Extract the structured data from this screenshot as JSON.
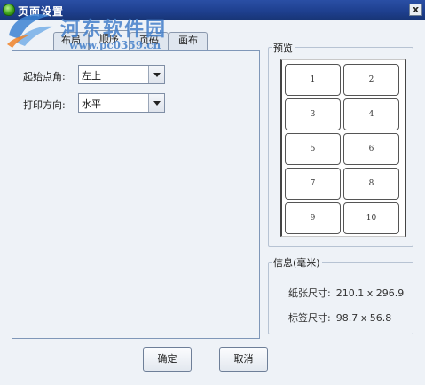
{
  "window": {
    "title": "页面设置",
    "close_label": "x"
  },
  "watermark": {
    "title": "河东软件园",
    "url": "www.pc0359.cn"
  },
  "tabs": [
    {
      "label": "布局"
    },
    {
      "label": "顺序"
    },
    {
      "label": "页码"
    },
    {
      "label": "画布"
    }
  ],
  "settings": {
    "start_corner": {
      "label": "起始点角:",
      "value": "左上"
    },
    "print_direction": {
      "label": "打印方向:",
      "value": "水平"
    }
  },
  "preview": {
    "title": "预览",
    "cells": [
      "1",
      "2",
      "3",
      "4",
      "5",
      "6",
      "7",
      "8",
      "9",
      "10"
    ]
  },
  "info": {
    "title": "信息(毫米)",
    "paper_size": {
      "label": "纸张尺寸:",
      "value": "210.1 x 296.9"
    },
    "label_size": {
      "label": "标签尺寸:",
      "value": "98.7 x 56.8"
    }
  },
  "buttons": {
    "ok": "确定",
    "cancel": "取消"
  }
}
